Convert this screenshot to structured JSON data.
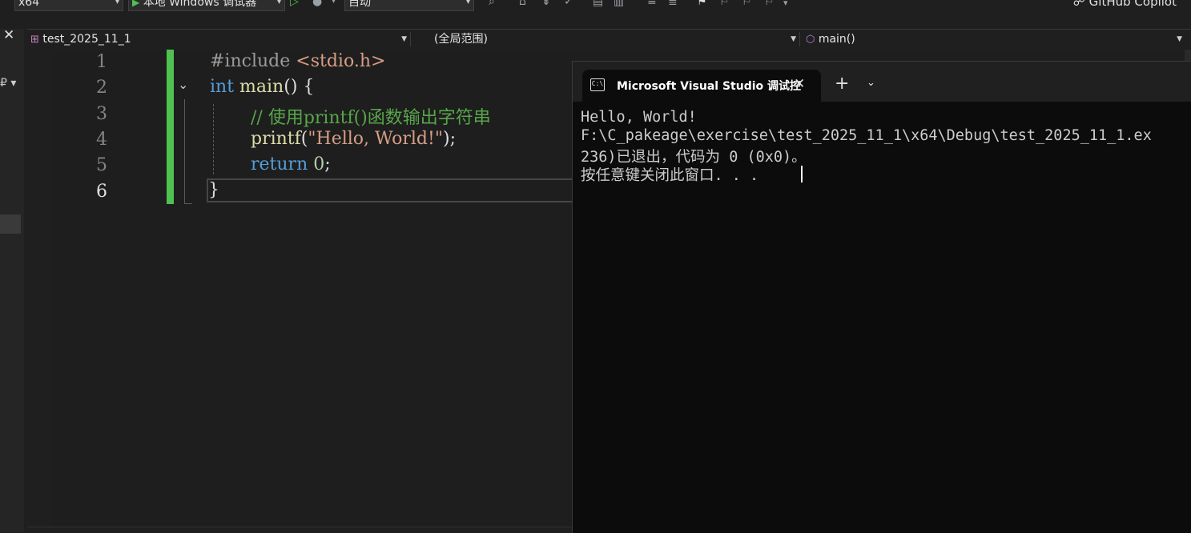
{
  "toolbar": {
    "platform": "x64",
    "debugger": "本地 Windows 调试器",
    "mode": "自动",
    "copilot": "GitHub Copilot"
  },
  "navbar": {
    "project": "test_2025_11_1",
    "scope": "(全局范围)",
    "member": "main()"
  },
  "editor": {
    "line_numbers": [
      "1",
      "2",
      "3",
      "4",
      "5",
      "6"
    ],
    "active_line": 6,
    "lines": {
      "l1": {
        "directive": "#include",
        "header": "<stdio.h>"
      },
      "l2": {
        "type": "int",
        "name": "main",
        "rest": "() {"
      },
      "l3": {
        "comment": "// 使用printf()函数输出字符串"
      },
      "l4": {
        "fn": "printf",
        "open": "(",
        "string": "\"Hello, World!\"",
        "close": ");"
      },
      "l5": {
        "keyword": "return",
        "value": "0",
        "end": ";"
      },
      "l6": {
        "brace": "}"
      }
    }
  },
  "console": {
    "tab_title": "Microsoft Visual Studio 调试控",
    "tab_icon_text": "C:\\",
    "lines": [
      "Hello, World!",
      "F:\\C_pakeage\\exercise\\test_2025_11_1\\x64\\Debug\\test_2025_11_1.ex",
      "236)已退出，代码为 0 (0x0)。",
      "按任意键关闭此窗口. . ."
    ]
  }
}
